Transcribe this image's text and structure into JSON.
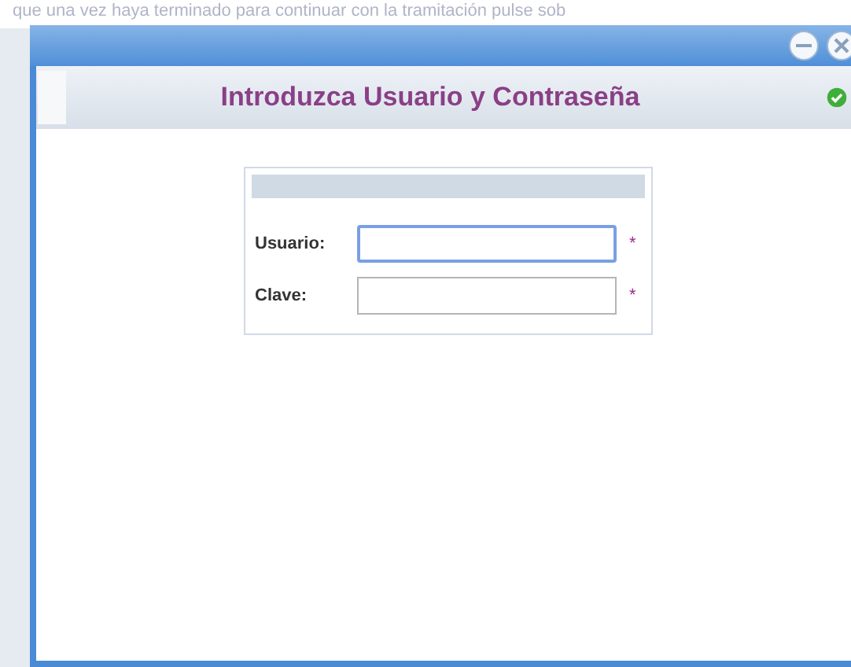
{
  "background_text": "que una vez haya terminado para continuar con la tramitación pulse sob",
  "dialog": {
    "title": "Introduzca Usuario y Contraseña",
    "fields": [
      {
        "label": "Usuario:",
        "required_mark": "*",
        "focused": true
      },
      {
        "label": "Clave:",
        "required_mark": "*",
        "focused": false
      }
    ]
  }
}
